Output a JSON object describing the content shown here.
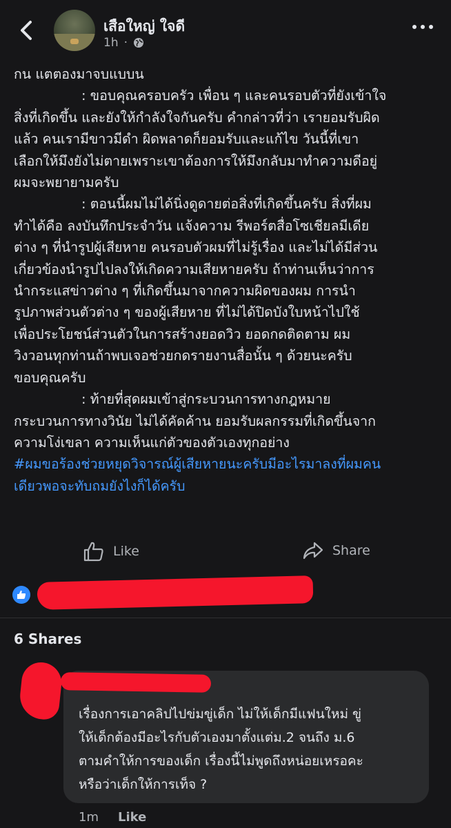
{
  "header": {
    "author_name": "เสือใหญ่ ใจดี",
    "time": "1h",
    "privacy_icon": "globe-icon",
    "back_icon": "chevron-left-icon",
    "more_icon": "more-dots-icon"
  },
  "post": {
    "lines": [
      "กน แตตองมาจบแบบน",
      ": ขอบคุณครอบครัว เพื่อน ๆ และคนรอบตัวที่ยังเข้าใจ",
      "สิ่งที่เกิดขึ้น และยังให้กำลังใจกันครับ คำกล่าวที่ว่า เรายอมรับผิด",
      "แล้ว คนเรามีขาวมีดำ ผิดพลาดก็ยอมรับและแก้ไข วันนี้ที่เขา",
      "เลือกให้มึงยังไม่ตายเพราะเขาต้องการให้มึงกลับมาทำความดีอยู่",
      "ผมจะพยายามครับ",
      ": ตอนนี้ผมไม่ได้นิ่งดูดายต่อสิ่งที่เกิดขึ้นครับ สิ่งที่ผม",
      "ทำได้คือ ลงบันทึกประจำวัน แจ้งความ รีพอร์ตสื่อโซเชียลมีเดีย",
      "ต่าง ๆ ที่นำรูปผู้เสียหาย คนรอบตัวผมที่ไม่รู้เรื่อง และไม่ได้มีส่วน",
      "เกี่ยวข้องนำรูปไปลงให้เกิดความเสียหายครับ ถ้าท่านเห็นว่าการ",
      "นำกระแสข่าวต่าง ๆ ที่เกิดขึ้นมาจากความผิดของผม การนำ",
      "รูปภาพส่วนตัวต่าง ๆ ของผู้เสียหาย ที่ไม่ได้ปิดบังใบหน้าไปใช้",
      "เพื่อประโยชน์ส่วนตัวในการสร้างยอดวิว ยอดกดติดตาม ผม",
      "วิงวอนทุกท่านถ้าพบเจอช่วยกดรายงานสื่อนั้น ๆ ด้วยนะครับ",
      "ขอบคุณครับ",
      ": ท้ายที่สุดผมเข้าสู่กระบวนการทางกฎหมาย",
      "กระบวนการทางวินัย ไม่ได้คัดค้าน ยอมรับผลกรรมที่เกิดขึ้นจาก",
      "ความโง่เขลา ความเห็นแก่ตัวของตัวเองทุกอย่าง"
    ],
    "hashtag_lines": [
      "#ผมขอร้องช่วยหยุดวิจารณ์ผู้เสียหายนะครับมีอะไรมาลงที่ผมคน",
      "เดียวพอจะทับถมยังไงก็ได้ครับ"
    ],
    "hashtag_color": "#4599ff"
  },
  "actions": {
    "like_label": "Like",
    "share_label": "Share"
  },
  "reactions": {
    "like_badge_color": "#2e89ff"
  },
  "shares": {
    "label": "6 Shares"
  },
  "comment": {
    "lines": [
      "เรื่องการเอาคลิปไปข่มขู่เด็ก ไม่ให้เด็กมีแฟนใหม่ ขู่",
      "ให้เด็กต้องมีอะไรกับตัวเองมาตั้งแต่ม.2 จนถึง ม.6",
      "ตามคำให้การของเด็ก เรื่องนี้ไม่พูดถึงหน่อยเหรอคะ",
      "หรือว่าเด็กให้การเท็จ ?"
    ],
    "time": "1m",
    "like_label": "Like"
  },
  "colors": {
    "background": "#161618",
    "text": "#e4e6eb",
    "muted": "#b0b3b8",
    "bubble": "#2a2b2d",
    "redaction": "#f5162c"
  }
}
